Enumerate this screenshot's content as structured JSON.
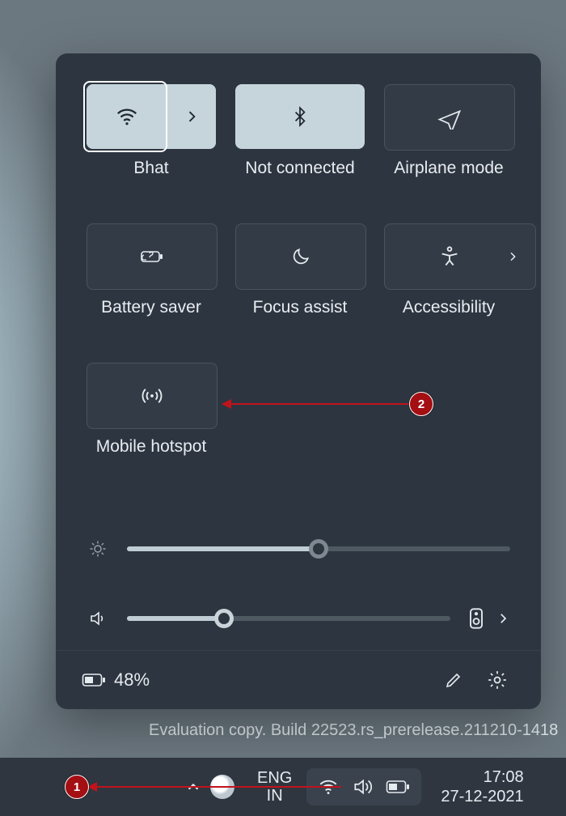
{
  "tiles": {
    "wifi": {
      "label": "Bhat"
    },
    "bluetooth": {
      "label": "Not connected"
    },
    "airplane": {
      "label": "Airplane mode"
    },
    "battery_saver": {
      "label": "Battery saver"
    },
    "focus_assist": {
      "label": "Focus assist"
    },
    "accessibility": {
      "label": "Accessibility"
    },
    "hotspot": {
      "label": "Mobile hotspot"
    }
  },
  "sliders": {
    "brightness_percent": 50,
    "volume_percent": 30
  },
  "footer": {
    "battery_text": "48%"
  },
  "taskbar": {
    "lang_top": "ENG",
    "lang_bottom": "IN",
    "time": "17:08",
    "date": "27-12-2021"
  },
  "watermark": "Evaluation copy. Build 22523.rs_prerelease.211210-1418",
  "annotations": {
    "badge1": "1",
    "badge2": "2"
  }
}
